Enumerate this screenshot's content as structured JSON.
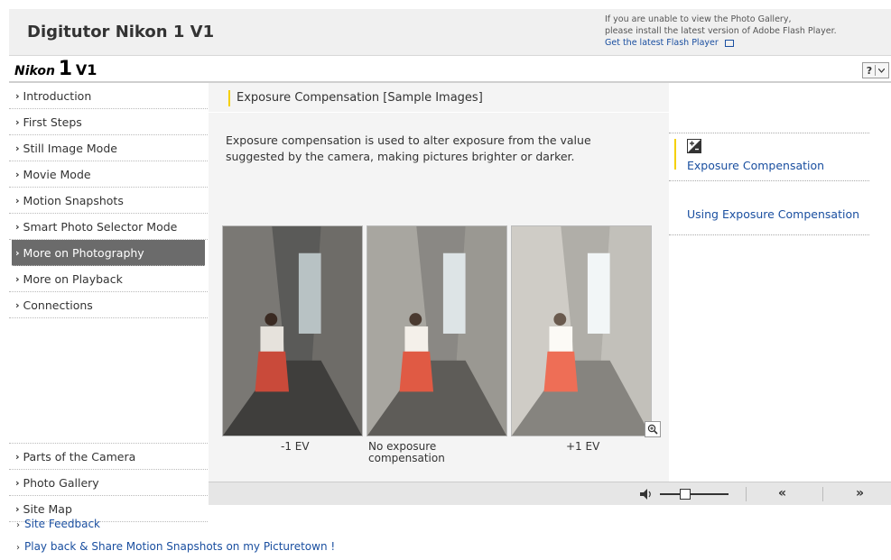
{
  "header": {
    "title": "Digitutor Nikon 1 V1",
    "notice_line1": "If you are unable to view the Photo Gallery,",
    "notice_line2": "please install the latest version of Adobe Flash Player.",
    "flash_link": "Get the latest Flash Player"
  },
  "brand": {
    "nikon": "Nikon",
    "one": "1",
    "model": "V1",
    "help_label": "?"
  },
  "sidebar": {
    "items": [
      {
        "label": "Introduction"
      },
      {
        "label": "First Steps"
      },
      {
        "label": "Still Image Mode"
      },
      {
        "label": "Movie Mode"
      },
      {
        "label": "Motion Snapshots"
      },
      {
        "label": "Smart Photo Selector Mode"
      },
      {
        "label": "More on Photography"
      },
      {
        "label": "More on Playback"
      },
      {
        "label": "Connections"
      }
    ],
    "bottom_items": [
      {
        "label": "Parts of the Camera"
      },
      {
        "label": "Photo Gallery"
      },
      {
        "label": "Site Map"
      }
    ]
  },
  "main": {
    "section_title": "Exposure Compensation [Sample Images]",
    "description": "Exposure compensation is used to alter exposure from the value suggested by the camera, making pictures brighter or darker.",
    "captions": {
      "minus": "-1 EV",
      "none_line1": "No exposure",
      "none_line2": "compensation",
      "plus": "+1 EV"
    }
  },
  "right_panel": {
    "link1": "Exposure Compensation",
    "link2": "Using Exposure Compensation"
  },
  "controls": {
    "prev": "«",
    "next": "»"
  },
  "footer": {
    "feedback": "Site Feedback",
    "picturetown": "Play back & Share Motion Snapshots on my Picturetown !"
  }
}
